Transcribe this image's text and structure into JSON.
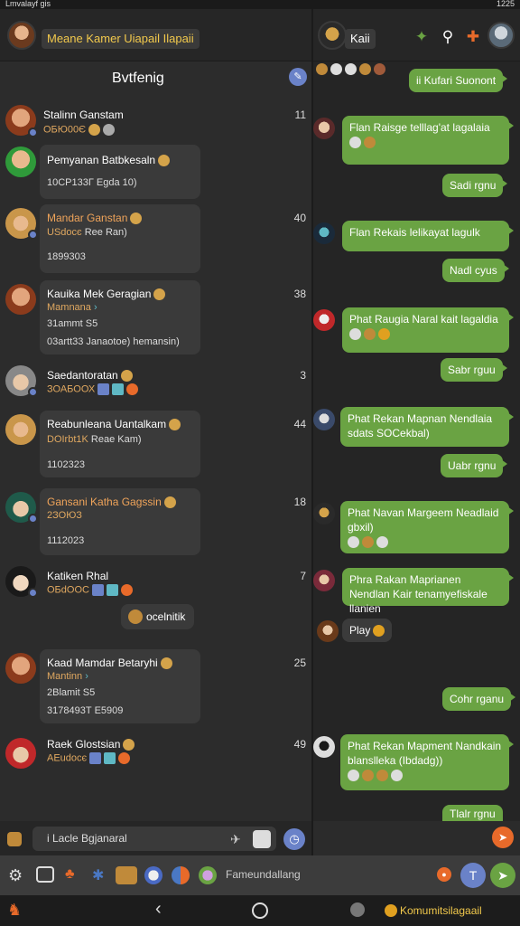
{
  "status_bar": {
    "left": "Lmvalayf gis",
    "time": "1225"
  },
  "header": {
    "left_title": "Meane Kamer Uiapail Ilapaii",
    "right_title": "Kaii"
  },
  "left_panel": {
    "list_title": "Bvtfenig",
    "contacts": [
      {
        "name": "Stalinn Ganstam",
        "name_color": "white",
        "sub": "OБЮ00Є",
        "count": "11"
      },
      {
        "name": "Pemyanan Batbkesaln",
        "name_color": "white",
        "sub": "10СР133Г Egda 10)",
        "count": ""
      },
      {
        "name": "Mandar Ganstan",
        "name_color": "orange",
        "sub": "USdocє",
        "sub_link": "Ree Ran)",
        "extra": "1899303",
        "count": "40"
      },
      {
        "name": "Kauika Mek Geragian",
        "name_color": "white",
        "sub": "Mamnana",
        "sub2": "31ammt  S5",
        "extra": "03artt33  Janaotoe) hemansin)",
        "count": "38"
      },
      {
        "name": "Saedantoratan",
        "name_color": "white",
        "sub": "ЗОАБООХ",
        "count": "3"
      },
      {
        "name": "Reabunleana Uantalkam",
        "name_color": "white",
        "sub": "DOIrbt1K",
        "sub_link": "Reae Kam)",
        "extra": "1102323",
        "count": "44"
      },
      {
        "name": "Gansani Katha Gagssin",
        "name_color": "orange",
        "sub": "2ЗОЮЗ",
        "extra": "1112023",
        "count": "18"
      },
      {
        "name": "Katiken Rhal",
        "name_color": "white",
        "sub": "OБdOOС",
        "count": "7"
      },
      {
        "name": "Kaad Mamdar Betaryhi",
        "name_color": "white",
        "sub": "Mantinn",
        "sub2": "2Blamit  S5",
        "extra": "3178493Т  E5909",
        "count": "25"
      },
      {
        "name": "Raek Glostsian",
        "name_color": "white",
        "sub": "AEudocє",
        "count": "49"
      }
    ],
    "pill_label": "ocelnitik",
    "input_placeholder": "i Lacle Bgjanaral"
  },
  "right_panel": {
    "messages": [
      {
        "type": "out",
        "text": "ii Kufari Suonont"
      },
      {
        "type": "out",
        "text": "Flan Raisge telllag'at lagalaia"
      },
      {
        "type": "out",
        "text": "Sadi rgnu"
      },
      {
        "type": "out",
        "text": "Flan Rekais lelikayat lagulk"
      },
      {
        "type": "out",
        "text": "Nadl cyus"
      },
      {
        "type": "out",
        "text": "Phat Raugia Naral kait lagaldia"
      },
      {
        "type": "out",
        "text": "Sabr rguu"
      },
      {
        "type": "out",
        "text": "Phat Rekan Mapnan Nendlaia sdats SOCekbal)"
      },
      {
        "type": "out",
        "text": "Uabr rgnu"
      },
      {
        "type": "out",
        "text": "Phat Navan Margeem Neadlaid gbxil)"
      },
      {
        "type": "out",
        "text": "Phra Rakan Maprianen Nendlan Kair tenamyefiskale llanien"
      },
      {
        "type": "in",
        "text": "Play"
      },
      {
        "type": "out",
        "text": "Cohr rganu"
      },
      {
        "type": "out",
        "text": "Phat Rekan Mapment Nandkain blanslleka (Ibdadg))"
      },
      {
        "type": "out",
        "text": "Tlalr rgnu"
      }
    ]
  },
  "toolbar": {
    "compose_placeholder": "Fameundallang"
  },
  "nav": {
    "right_label": "Komumitsilagaail"
  },
  "colors": {
    "accent_green": "#6aa343",
    "accent_blue": "#6a82c8",
    "accent_orange": "#e86a2a"
  }
}
